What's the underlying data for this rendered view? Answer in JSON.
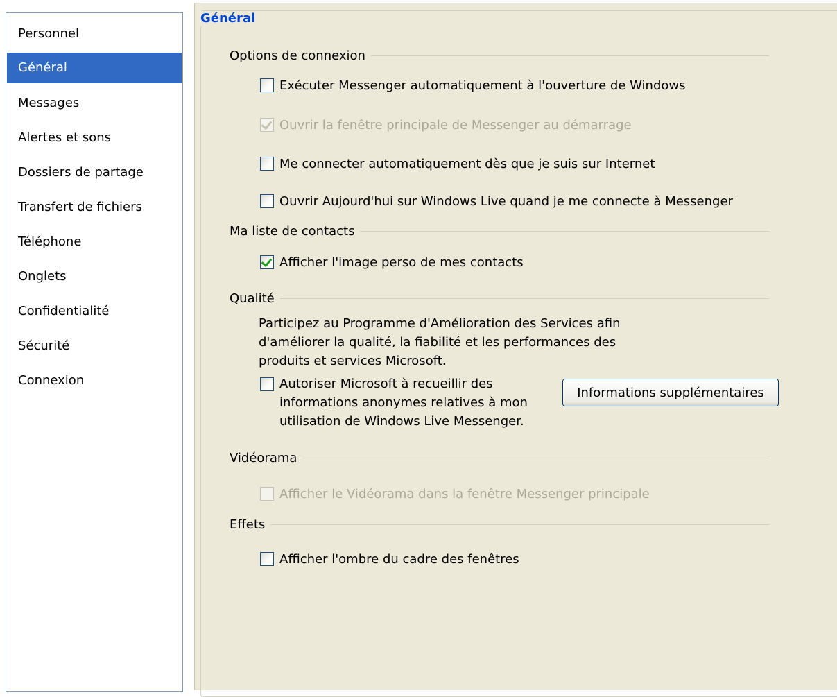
{
  "sidebar": {
    "items": [
      {
        "label": "Personnel"
      },
      {
        "label": "Général",
        "selected": true
      },
      {
        "label": "Messages"
      },
      {
        "label": "Alertes et sons"
      },
      {
        "label": "Dossiers de partage"
      },
      {
        "label": "Transfert de fichiers"
      },
      {
        "label": "Téléphone"
      },
      {
        "label": "Onglets"
      },
      {
        "label": "Confidentialité"
      },
      {
        "label": "Sécurité"
      },
      {
        "label": "Connexion"
      }
    ]
  },
  "main": {
    "title": "Général",
    "sections": {
      "connexion": {
        "label": "Options de connexion",
        "options": [
          {
            "label": "Exécuter Messenger automatiquement à l'ouverture de Windows",
            "checked": false,
            "enabled": true
          },
          {
            "label": "Ouvrir la fenêtre principale de Messenger au démarrage",
            "checked": true,
            "enabled": false
          },
          {
            "label": "Me connecter automatiquement dès que je suis sur Internet",
            "checked": false,
            "enabled": true
          },
          {
            "label": "Ouvrir Aujourd'hui sur Windows Live quand je me connecte à Messenger",
            "checked": false,
            "enabled": true
          }
        ]
      },
      "contacts": {
        "label": "Ma liste de contacts",
        "options": [
          {
            "label": "Afficher l'image perso de mes contacts",
            "checked": true,
            "enabled": true
          }
        ]
      },
      "qualite": {
        "label": "Qualité",
        "description": "Participez au Programme d'Amélioration des Services afin d'améliorer la qualité, la fiabilité et les performances des produits et services Microsoft.",
        "option": {
          "label": "Autoriser Microsoft à recueillir des informations anonymes relatives à mon utilisation de Windows Live Messenger.",
          "checked": false,
          "enabled": true
        },
        "button_label": "Informations supplémentaires"
      },
      "videorama": {
        "label": "Vidéorama",
        "options": [
          {
            "label": "Afficher le Vidéorama dans la fenêtre Messenger principale",
            "checked": false,
            "enabled": false
          }
        ]
      },
      "effets": {
        "label": "Effets",
        "options": [
          {
            "label": "Afficher l'ombre du cadre des fenêtres",
            "checked": false,
            "enabled": true
          }
        ]
      }
    }
  },
  "colors": {
    "selection": "#316ac5",
    "title": "#0046d5",
    "panel_bg": "#ece9d8",
    "disabled_text": "#aca899",
    "checkmark": "#21a121"
  }
}
